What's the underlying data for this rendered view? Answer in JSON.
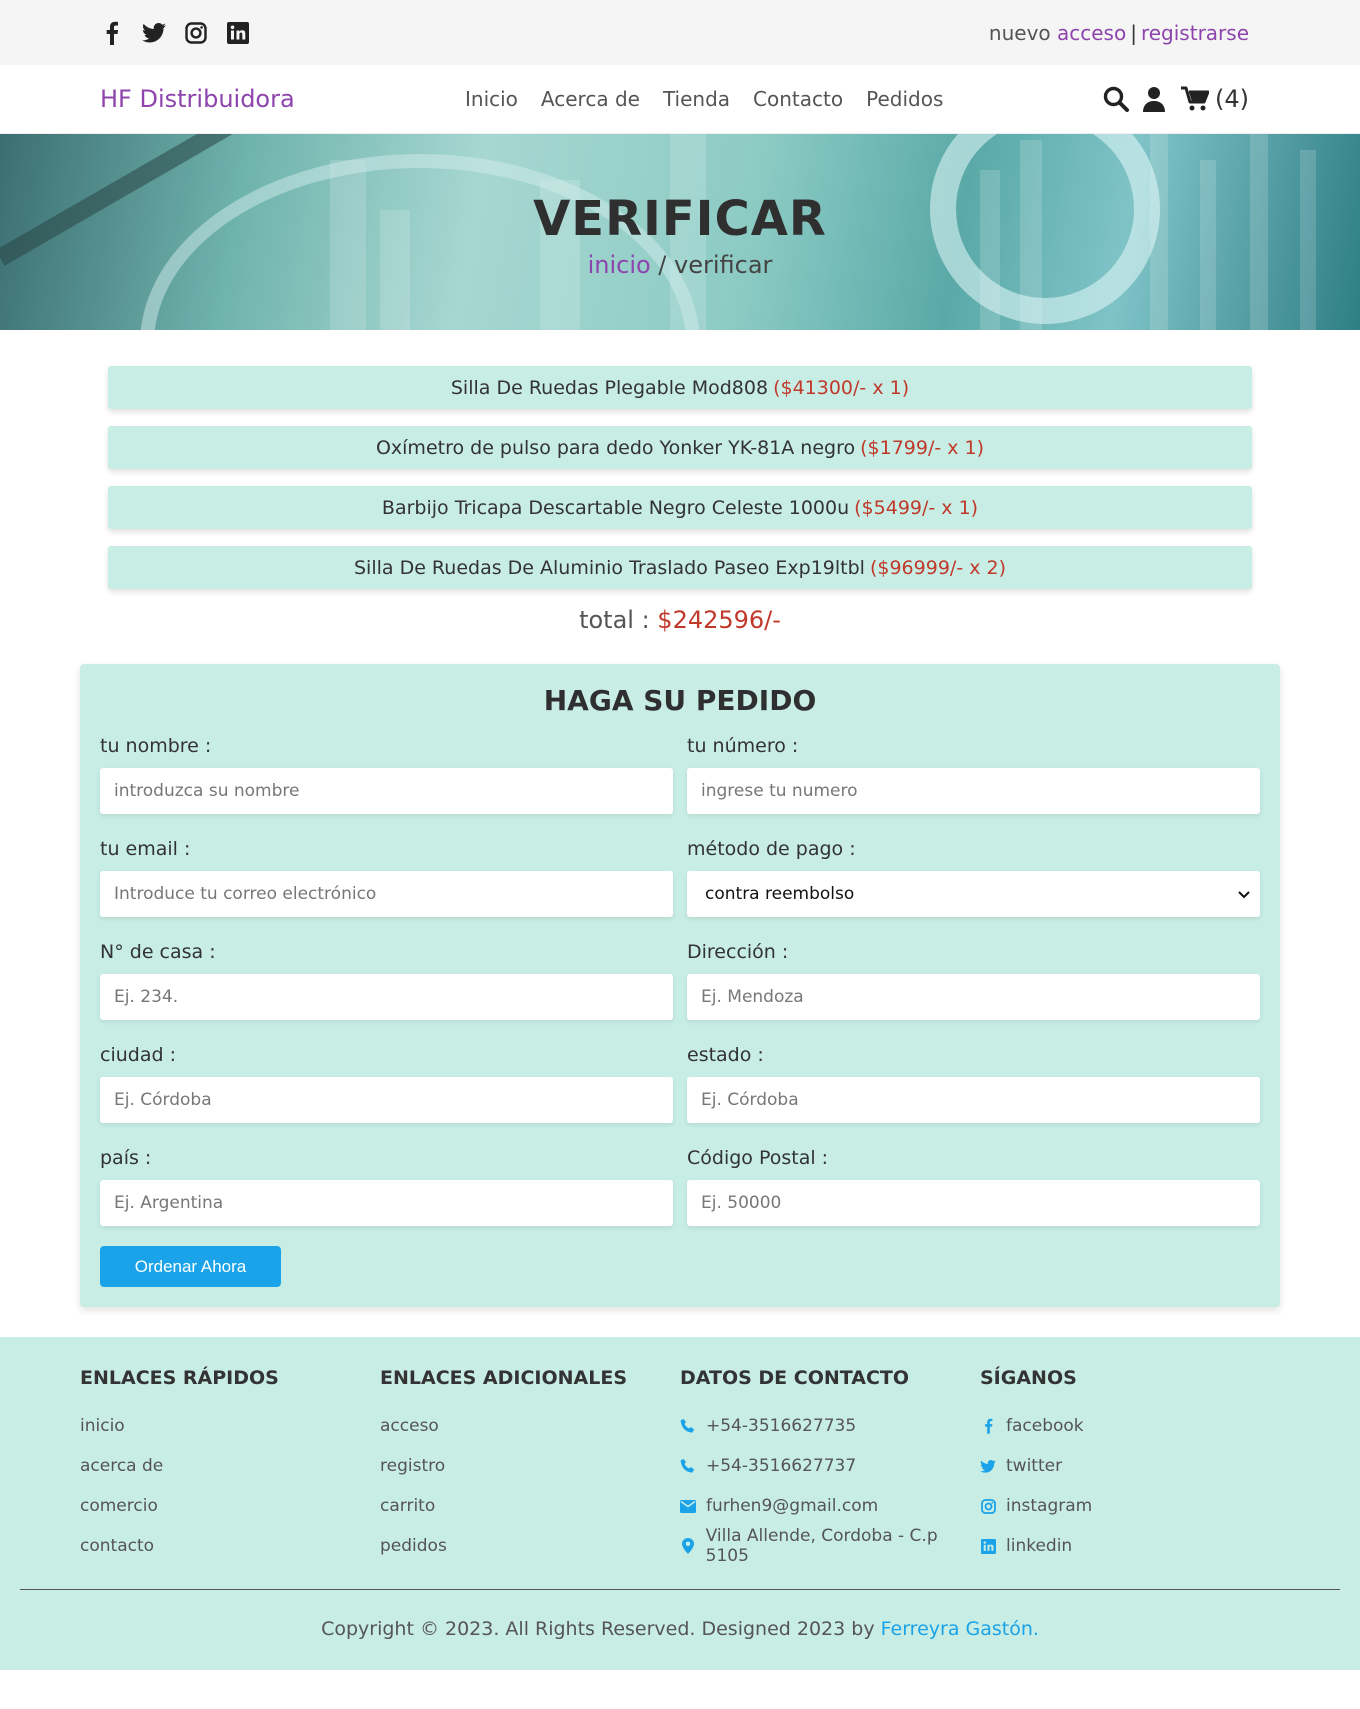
{
  "topbar": {
    "social_icons": [
      "facebook-icon",
      "twitter-icon",
      "instagram-icon",
      "linkedin-icon"
    ],
    "auth_prefix": "nuevo",
    "login": "acceso",
    "separator": "|",
    "register": "registrarse"
  },
  "navbar": {
    "brand": "HF Distribuidora",
    "menu": [
      "Inicio",
      "Acerca de",
      "Tienda",
      "Contacto",
      "Pedidos"
    ],
    "cart_count": "(4)"
  },
  "hero": {
    "title": "VERIFICAR",
    "crumb_home": "inicio",
    "crumb_rest": " / verificar"
  },
  "order_items": [
    {
      "name": "Silla De Ruedas Plegable Mod808",
      "price": "($41300/- x 1)"
    },
    {
      "name": "Oxímetro de pulso para dedo Yonker YK-81A negro",
      "price": "($1799/- x 1)"
    },
    {
      "name": "Barbijo Tricapa Descartable Negro Celeste 1000u",
      "price": "($5499/- x 1)"
    },
    {
      "name": "Silla De Ruedas De Aluminio Traslado Paseo Exp19ltbl",
      "price": "($96999/- x 2)"
    }
  ],
  "total": {
    "label": "total :",
    "amount": "$242596/-"
  },
  "form": {
    "title": "HAGA SU PEDIDO",
    "fields": {
      "nombre": {
        "label": "tu nombre :",
        "placeholder": "introduzca su nombre"
      },
      "numero": {
        "label": "tu número :",
        "placeholder": "ingrese tu numero"
      },
      "email": {
        "label": "tu email :",
        "placeholder": "Introduce tu correo electrónico"
      },
      "pago": {
        "label": "método de pago :",
        "value": "contra reembolso"
      },
      "casa": {
        "label": "N° de casa :",
        "placeholder": "Ej. 234."
      },
      "direccion": {
        "label": "Dirección :",
        "placeholder": "Ej. Mendoza"
      },
      "ciudad": {
        "label": "ciudad :",
        "placeholder": "Ej. Córdoba"
      },
      "estado": {
        "label": "estado :",
        "placeholder": "Ej. Córdoba"
      },
      "pais": {
        "label": "país :",
        "placeholder": "Ej. Argentina"
      },
      "postal": {
        "label": "Código Postal :",
        "placeholder": "Ej. 50000"
      }
    },
    "submit": "Ordenar Ahora"
  },
  "footer": {
    "quick": {
      "title": "ENLACES RÁPIDOS",
      "links": [
        "inicio",
        "acerca de",
        "comercio",
        "contacto"
      ]
    },
    "extra": {
      "title": "ENLACES ADICIONALES",
      "links": [
        "acceso",
        "registro",
        "carrito",
        "pedidos"
      ]
    },
    "contact": {
      "title": "DATOS DE CONTACTO",
      "phone1": "+54-3516627735",
      "phone2": "+54-3516627737",
      "email": "furhen9@gmail.com",
      "address": "Villa Allende, Cordoba - C.p 5105"
    },
    "follow": {
      "title": "SÍGANOS",
      "links": [
        "facebook",
        "twitter",
        "instagram",
        "linkedin"
      ]
    },
    "copyright": "Copyright © 2023. All Rights Reserved. Designed 2023 by",
    "author": "Ferreyra Gastón."
  },
  "colors": {
    "accent": "#8e44ad",
    "mint": "#c7ede4",
    "price": "#c0392b",
    "button": "#1aa3e8"
  }
}
